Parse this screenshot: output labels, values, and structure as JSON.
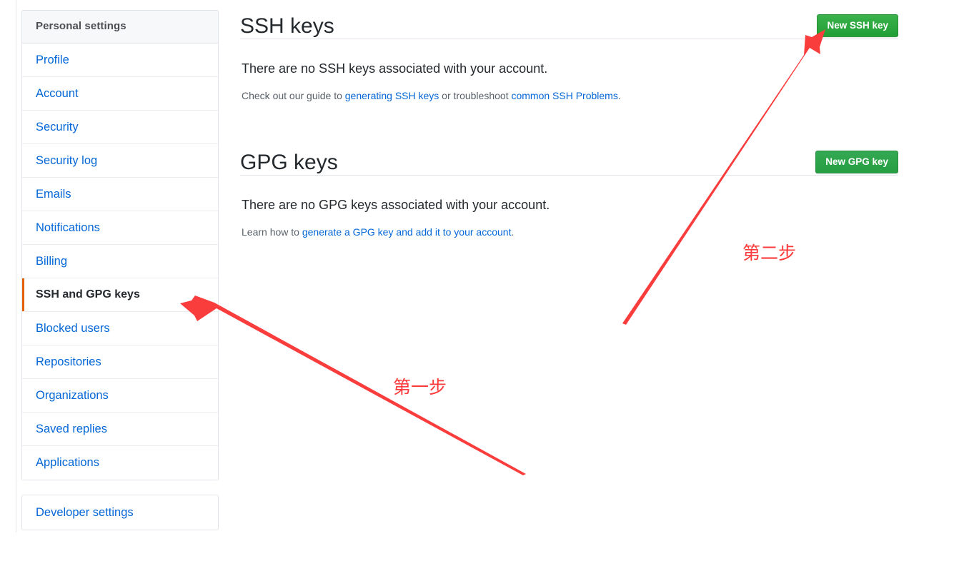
{
  "sidebar": {
    "heading": "Personal settings",
    "items": [
      {
        "label": "Profile",
        "selected": false
      },
      {
        "label": "Account",
        "selected": false
      },
      {
        "label": "Security",
        "selected": false
      },
      {
        "label": "Security log",
        "selected": false
      },
      {
        "label": "Emails",
        "selected": false
      },
      {
        "label": "Notifications",
        "selected": false
      },
      {
        "label": "Billing",
        "selected": false
      },
      {
        "label": "SSH and GPG keys",
        "selected": true
      },
      {
        "label": "Blocked users",
        "selected": false
      },
      {
        "label": "Repositories",
        "selected": false
      },
      {
        "label": "Organizations",
        "selected": false
      },
      {
        "label": "Saved replies",
        "selected": false
      },
      {
        "label": "Applications",
        "selected": false
      }
    ],
    "developer_settings": "Developer settings"
  },
  "ssh_section": {
    "title": "SSH keys",
    "button_label": "New SSH key",
    "empty_message": "There are no SSH keys associated with your account.",
    "help_prefix": "Check out our guide to ",
    "help_link1": "generating SSH keys",
    "help_middle": " or troubleshoot ",
    "help_link2": "common SSH Problems",
    "help_suffix": "."
  },
  "gpg_section": {
    "title": "GPG keys",
    "button_label": "New GPG key",
    "empty_message": "There are no GPG keys associated with your account.",
    "help_prefix": "Learn how to ",
    "help_link1": "generate a GPG key and add it to your account",
    "help_suffix": "."
  },
  "annotations": {
    "step1": "第一步",
    "step2": "第二步",
    "arrow_color": "#fb3b3b"
  },
  "colors": {
    "link": "#0366d6",
    "text": "#24292e",
    "muted": "#586069",
    "border": "#e1e4e8",
    "selected_marker": "#e36209",
    "button_green": "#2ea44f",
    "annotation_red": "#fb3b3b"
  }
}
